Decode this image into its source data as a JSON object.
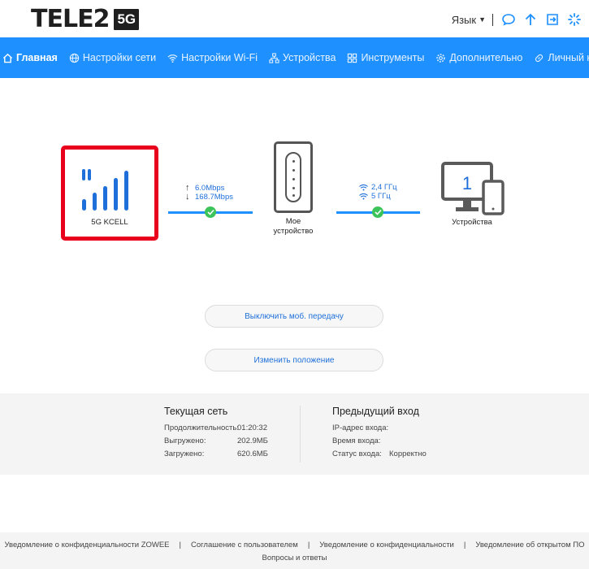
{
  "header": {
    "logo_text": "TELE2",
    "logo_badge": "5G",
    "language_label": "Язык",
    "icons": [
      "message-icon",
      "upload-icon",
      "logout-icon",
      "loading-icon"
    ]
  },
  "nav": {
    "items": [
      {
        "label": "Главная",
        "icon": "home-icon",
        "active": true
      },
      {
        "label": "Настройки сети",
        "icon": "globe-icon"
      },
      {
        "label": "Настройки Wi-Fi",
        "icon": "wifi-icon"
      },
      {
        "label": "Устройства",
        "icon": "devices-icon"
      },
      {
        "label": "Инструменты",
        "icon": "tools-icon"
      },
      {
        "label": "Дополнительно",
        "icon": "gear-icon"
      },
      {
        "label": "Личный кабинет",
        "icon": "link-icon"
      }
    ]
  },
  "network": {
    "operator_label": "5G KCELL",
    "upload_speed": "6.0Mbps",
    "download_speed": "168.7Mbps",
    "device_label_line1": "Мое",
    "device_label_line2": "устройство",
    "freq_1": "2,4 ГГц",
    "freq_2": "5 ГГц",
    "devices_count": "1",
    "devices_label": "Устройства"
  },
  "actions": {
    "disable_mobile_data": "Выключить моб. передачу",
    "change_position": "Изменить положение"
  },
  "current_network": {
    "title": "Текущая сеть",
    "rows": [
      {
        "label": "Продолжительность:",
        "value": "01:20:32"
      },
      {
        "label": "Выгружено:",
        "value": "202.9МБ"
      },
      {
        "label": "Загружено:",
        "value": "620.6МБ"
      }
    ]
  },
  "previous_login": {
    "title": "Предыдущий вход",
    "rows": [
      {
        "label": "IP-адрес входа:",
        "value": ""
      },
      {
        "label": "Время входа:",
        "value": ""
      },
      {
        "label": "Статус входа:",
        "value": "Корректно"
      }
    ]
  },
  "footer": {
    "links": [
      "Уведомление о конфиденциальности ZOWEE",
      "Соглашение с пользователем",
      "Уведомление о конфиденциальности",
      "Уведомление об открытом ПО"
    ],
    "faq": "Вопросы и ответы"
  },
  "colors": {
    "accent": "#1e90ff",
    "signal_frame": "#e8001c",
    "ok": "#3cc35a",
    "link_text": "#1e6fd9"
  }
}
